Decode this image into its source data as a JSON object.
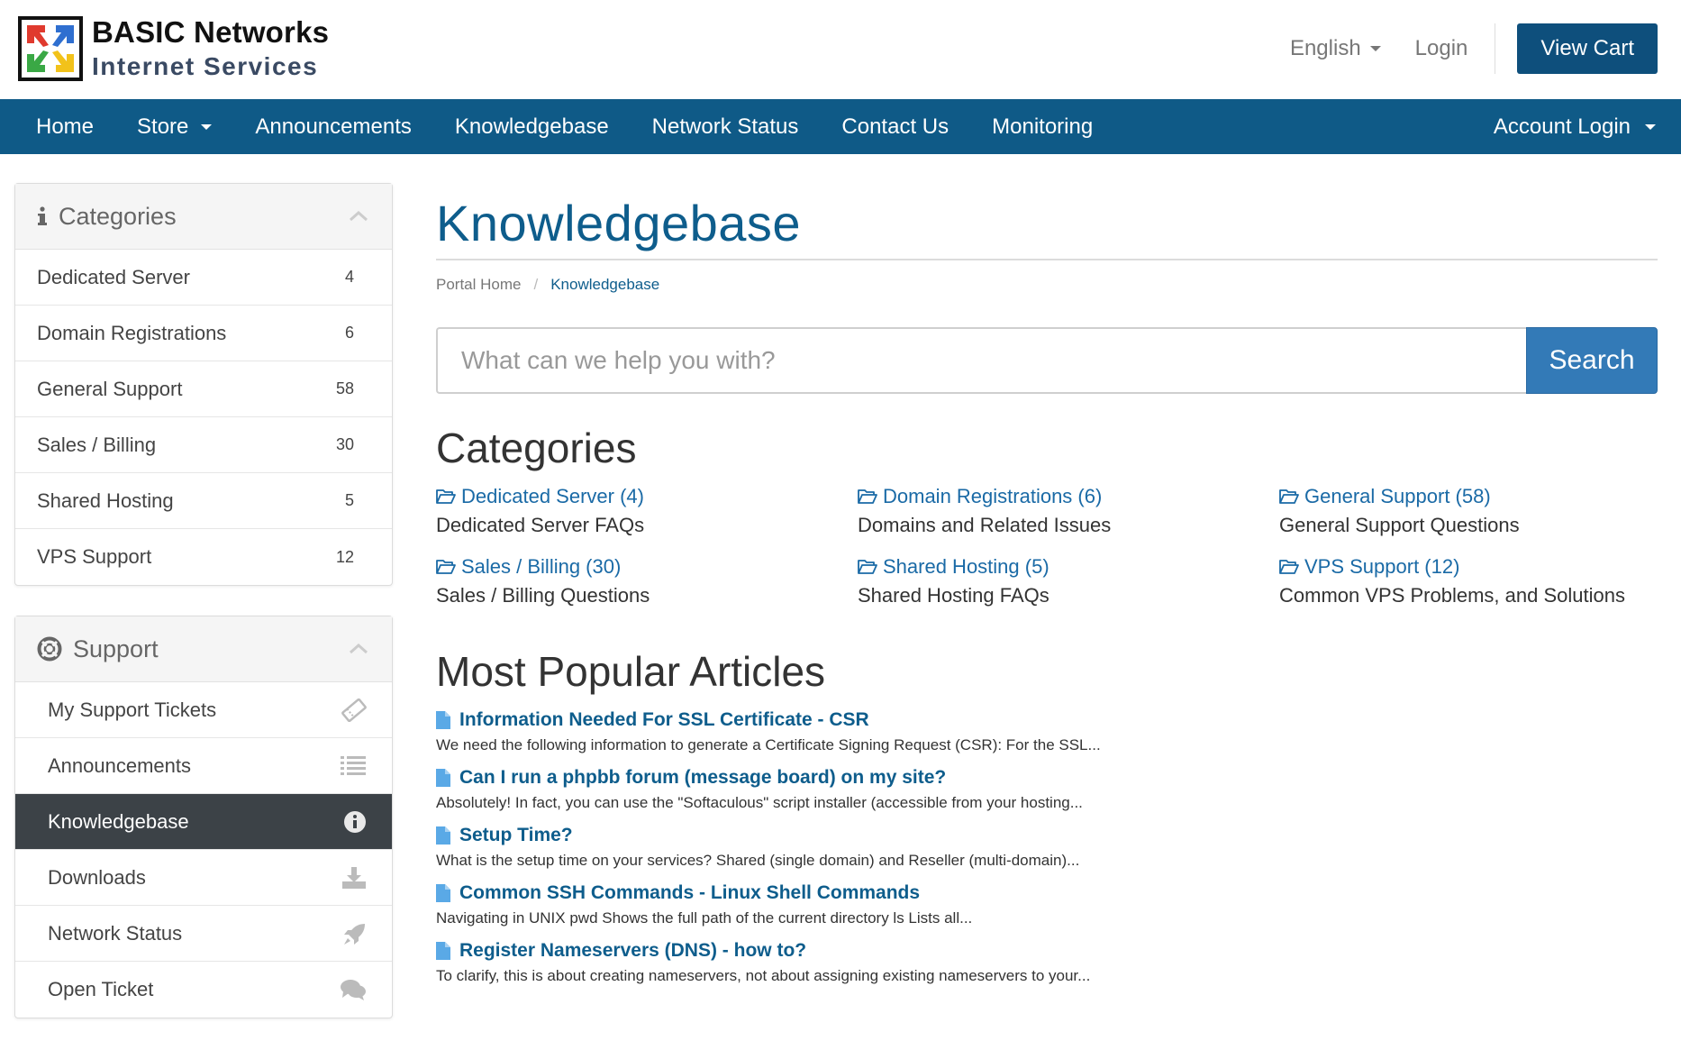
{
  "brand": {
    "title": "BASIC Networks",
    "subtitle": "Internet Services"
  },
  "topbar": {
    "language": "English",
    "login": "Login",
    "view_cart": "View Cart"
  },
  "nav": {
    "items": [
      {
        "label": "Home"
      },
      {
        "label": "Store"
      },
      {
        "label": "Announcements"
      },
      {
        "label": "Knowledgebase"
      },
      {
        "label": "Network Status"
      },
      {
        "label": "Contact Us"
      },
      {
        "label": "Monitoring"
      }
    ],
    "account": "Account Login"
  },
  "sidebar": {
    "categories": {
      "title": "Categories",
      "items": [
        {
          "label": "Dedicated Server",
          "count": "4"
        },
        {
          "label": "Domain Registrations",
          "count": "6"
        },
        {
          "label": "General Support",
          "count": "58"
        },
        {
          "label": "Sales / Billing",
          "count": "30"
        },
        {
          "label": "Shared Hosting",
          "count": "5"
        },
        {
          "label": "VPS Support",
          "count": "12"
        }
      ]
    },
    "support": {
      "title": "Support",
      "items": [
        {
          "label": "My Support Tickets",
          "icon": "ticket-icon"
        },
        {
          "label": "Announcements",
          "icon": "list-icon"
        },
        {
          "label": "Knowledgebase",
          "icon": "info-icon"
        },
        {
          "label": "Downloads",
          "icon": "download-icon"
        },
        {
          "label": "Network Status",
          "icon": "rocket-icon"
        },
        {
          "label": "Open Ticket",
          "icon": "comments-icon"
        }
      ],
      "active": "Knowledgebase"
    }
  },
  "main": {
    "title": "Knowledgebase",
    "breadcrumb": [
      "Portal Home",
      "Knowledgebase"
    ],
    "search": {
      "placeholder": "What can we help you with?",
      "button": "Search"
    },
    "categories_title": "Categories",
    "categories": [
      {
        "link": "Dedicated Server (4)",
        "desc": "Dedicated Server FAQs"
      },
      {
        "link": "Domain Registrations (6)",
        "desc": "Domains and Related Issues"
      },
      {
        "link": "General Support (58)",
        "desc": "General Support Questions"
      },
      {
        "link": "Sales / Billing (30)",
        "desc": "Sales / Billing Questions"
      },
      {
        "link": "Shared Hosting (5)",
        "desc": "Shared Hosting FAQs"
      },
      {
        "link": "VPS Support (12)",
        "desc": "Common VPS Problems, and Solutions"
      }
    ],
    "articles_title": "Most Popular Articles",
    "articles": [
      {
        "title": "Information Needed For SSL Certificate - CSR",
        "desc": "We need the following information to generate a Certificate Signing Request (CSR): For the SSL..."
      },
      {
        "title": "Can I run a phpbb forum (message board) on my site?",
        "desc": "Absolutely! In fact, you can use the \"Softaculous\" script installer (accessible from your hosting..."
      },
      {
        "title": "Setup Time?",
        "desc": "What is the setup time on your services? Shared (single domain) and Reseller (multi-domain)..."
      },
      {
        "title": "Common SSH Commands - Linux Shell Commands",
        "desc": "Navigating in UNIX pwd Shows the full path of the current directory ls Lists all..."
      },
      {
        "title": "Register Nameservers (DNS) - how to?",
        "desc": "To clarify, this is about creating nameservers, not about assigning existing nameservers to your..."
      }
    ]
  },
  "colors": {
    "nav_bg": "#0f5a87",
    "accent": "#0e5d8c",
    "search_btn": "#337ab7",
    "active_row": "#3c4247"
  }
}
